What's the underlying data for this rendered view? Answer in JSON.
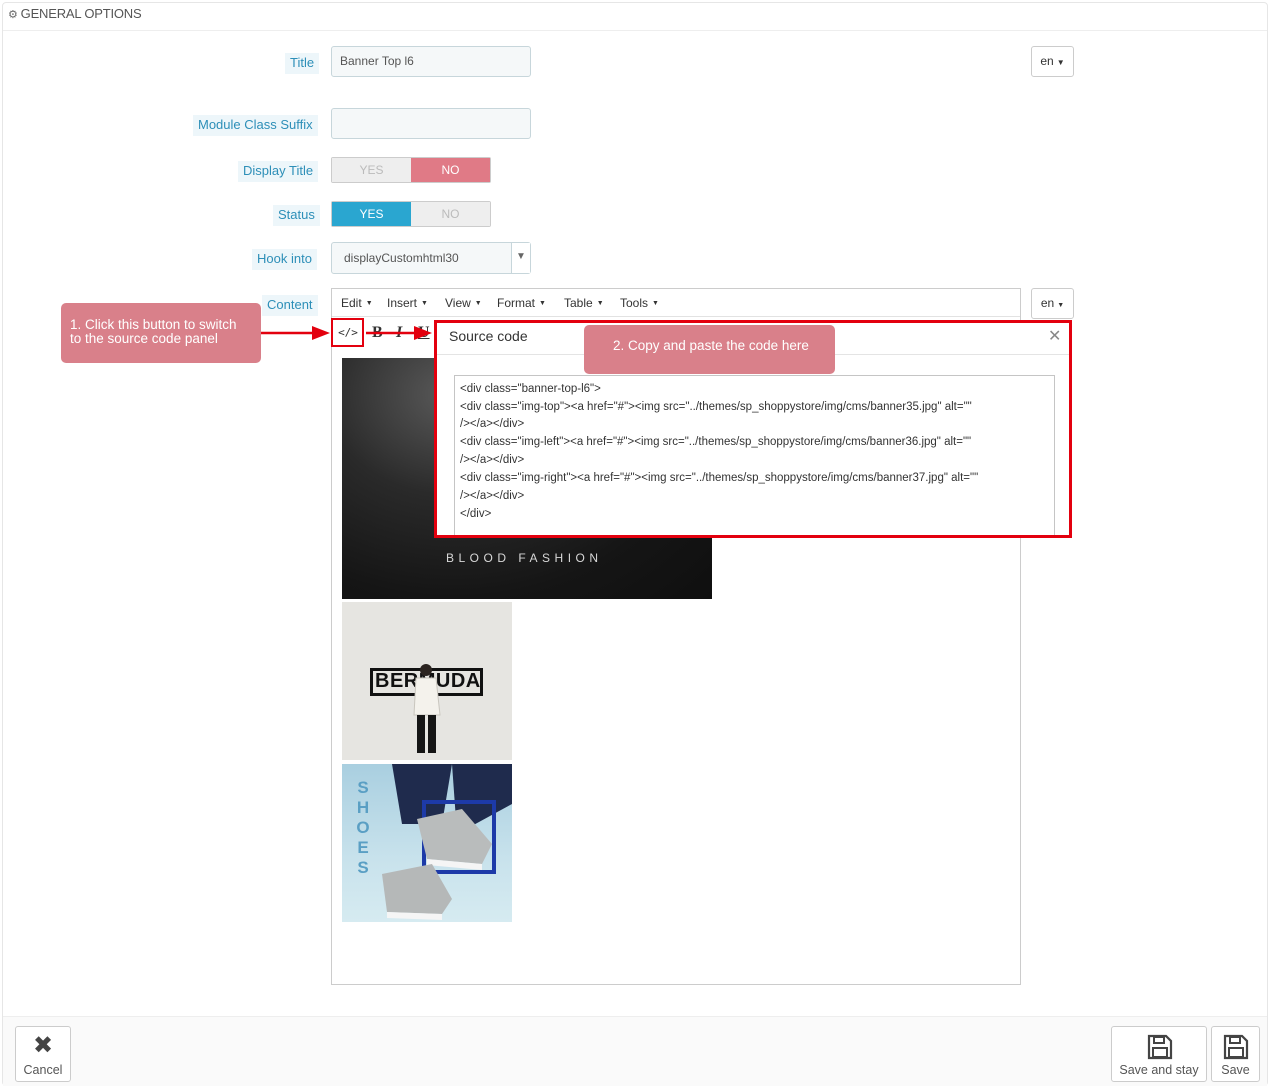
{
  "panel": {
    "heading": "GENERAL OPTIONS"
  },
  "form": {
    "title_label": "Title",
    "title_value": "Banner Top l6",
    "lang": "en",
    "suffix_label": "Module Class Suffix",
    "suffix_value": "",
    "display_title_label": "Display Title",
    "display_title_yes": "YES",
    "display_title_no": "NO",
    "display_title_selected": "NO",
    "status_label": "Status",
    "status_yes": "YES",
    "status_no": "NO",
    "status_selected": "YES",
    "hook_label": "Hook into",
    "hook_value": "displayCustomhtml30",
    "content_label": "Content",
    "content_lang": "en"
  },
  "editor": {
    "menus": [
      "Edit",
      "Insert",
      "View",
      "Format",
      "Table",
      "Tools"
    ],
    "images": {
      "blood": "BLOOD FASHION",
      "bermuda": "BERMUDA",
      "shoes": "SHOES"
    }
  },
  "source_modal": {
    "title": "Source code",
    "code_lines": [
      "<div class=\"banner-top-l6\">",
      "<div class=\"img-top\"><a href=\"#\"><img src=\"../themes/sp_shoppystore/img/cms/banner35.jpg\" alt=\"\"",
      "/></a></div>",
      "<div class=\"img-left\"><a href=\"#\"><img src=\"../themes/sp_shoppystore/img/cms/banner36.jpg\" alt=\"\"",
      "/></a></div>",
      "<div class=\"img-right\"><a href=\"#\"><img src=\"../themes/sp_shoppystore/img/cms/banner37.jpg\" alt=\"\"",
      "/></a></div>",
      "</div>"
    ]
  },
  "callouts": {
    "step1_line1": "1. Click this button to switch",
    "step1_line2": "to the source code panel",
    "step2": "2. Copy and paste the code here"
  },
  "footer": {
    "cancel": "Cancel",
    "save_and_stay": "Save and stay",
    "save": "Save"
  },
  "colors": {
    "accent_red": "#e3000e",
    "callout": "#d9808a",
    "yes_blue": "#2aa6d0",
    "no_pink": "#e07a86",
    "label_blue": "#2d8fb8"
  }
}
